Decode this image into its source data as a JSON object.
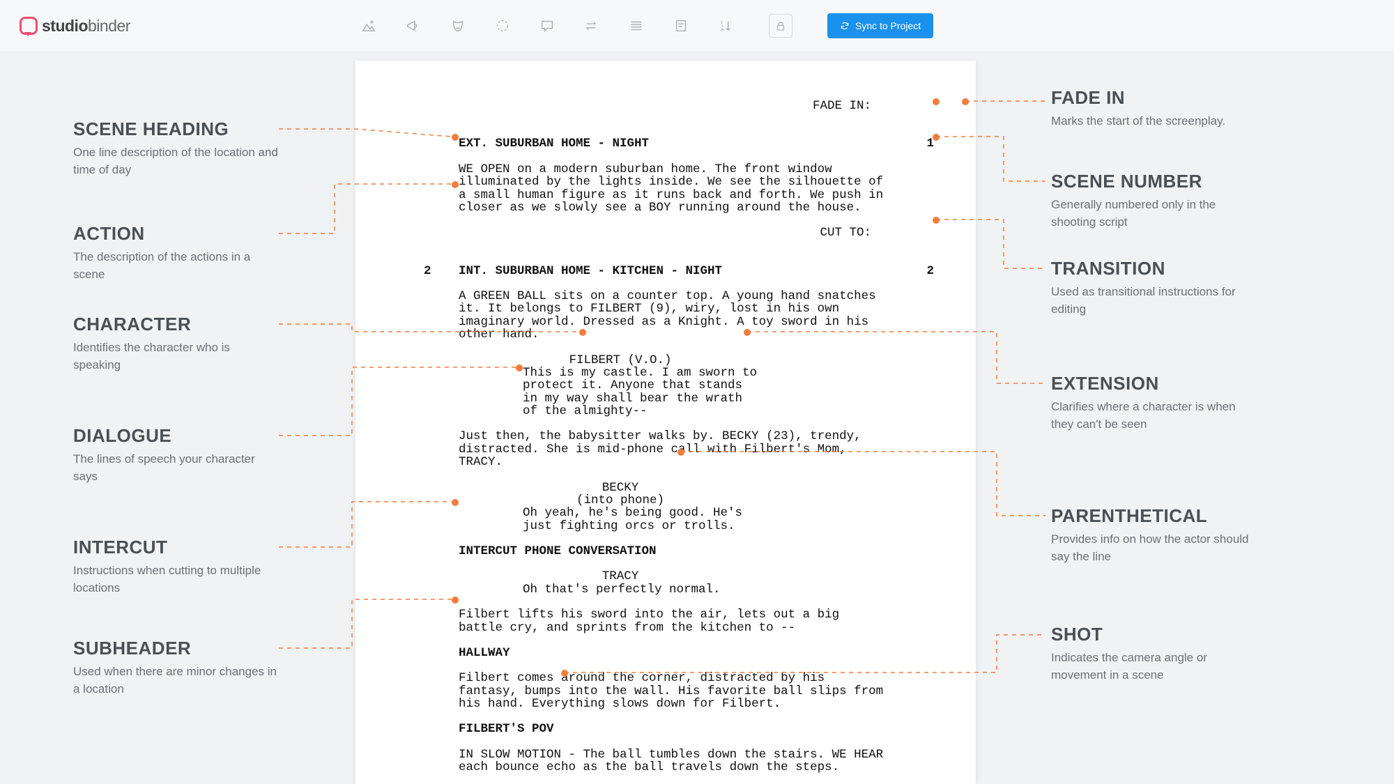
{
  "brand": {
    "name_bold": "studio",
    "name_light": "binder"
  },
  "toolbar": {
    "sync_label": "Sync to Project"
  },
  "left_annotations": {
    "scene_heading": {
      "title": "SCENE HEADING",
      "desc": "One line description of the location and time of day"
    },
    "action": {
      "title": "ACTION",
      "desc": "The description of the actions in a scene"
    },
    "character": {
      "title": "CHARACTER",
      "desc": "Identifies the character who is speaking"
    },
    "dialogue": {
      "title": "DIALOGUE",
      "desc": "The lines of speech your character says"
    },
    "intercut": {
      "title": "INTERCUT",
      "desc": "Instructions when cutting to multiple locations"
    },
    "subheader": {
      "title": "SUBHEADER",
      "desc": "Used when there are minor changes in a location"
    }
  },
  "right_annotations": {
    "fadein": {
      "title": "FADE IN",
      "desc": "Marks the start of the screenplay."
    },
    "scenenum": {
      "title": "SCENE NUMBER",
      "desc": "Generally numbered only in the shooting script"
    },
    "transition": {
      "title": "TRANSITION",
      "desc": "Used as transitional instructions for editing"
    },
    "extension": {
      "title": "EXTENSION",
      "desc": "Clarifies where a character is when they can't be seen"
    },
    "parenthetical": {
      "title": "PARENTHETICAL",
      "desc": "Provides info on how the actor should say the line"
    },
    "shot": {
      "title": "SHOT",
      "desc": "Indicates the camera angle or movement in a scene"
    }
  },
  "script": {
    "fade_in": "FADE IN:",
    "scene1_num": "1",
    "scene1_slug": "EXT. SUBURBAN HOME - NIGHT",
    "scene1_action": "WE OPEN on a modern suburban home. The front window illuminated by the lights inside. We see the silhouette of a small human figure as it runs back and forth. We push in closer as we slowly see a BOY running around the house.",
    "cut_to": "CUT TO:",
    "scene2_num_l": "2",
    "scene2_num_r": "2",
    "scene2_slug": "INT. SUBURBAN HOME - KITCHEN - NIGHT",
    "scene2_action1": "A GREEN BALL sits on a counter top. A young hand snatches it. It belongs to FILBERT (9), wiry, lost in his own imaginary world. Dressed as a Knight. A toy sword in his other hand.",
    "char_filbert_vo": "FILBERT (V.O.)",
    "dialog_filbert": "This is my castle. I am sworn to protect it. Anyone that stands in my way shall bear the wrath of the almighty--",
    "scene2_action2": "Just then, the babysitter walks by. BECKY (23), trendy, distracted. She is mid-phone call with Filbert's Mom, TRACY.",
    "char_becky": "BECKY",
    "paren_becky": "(into phone)",
    "dialog_becky": "Oh yeah, he's being good. He's just fighting orcs or trolls.",
    "intercut": "INTERCUT PHONE CONVERSATION",
    "char_tracy": "TRACY",
    "dialog_tracy": "Oh that's perfectly normal.",
    "scene2_action3": "Filbert lifts his sword into the air, lets out a big battle cry, and sprints from the kitchen to --",
    "sub_hallway": "HALLWAY",
    "scene2_action4": "Filbert comes around the corner, distracted by his fantasy, bumps into the wall. His favorite ball slips from his hand. Everything slows down for Filbert.",
    "sub_pov": "FILBERT'S POV",
    "scene2_action5": "IN SLOW MOTION - The ball tumbles down the stairs. WE HEAR each bounce echo as the ball travels down the steps."
  }
}
